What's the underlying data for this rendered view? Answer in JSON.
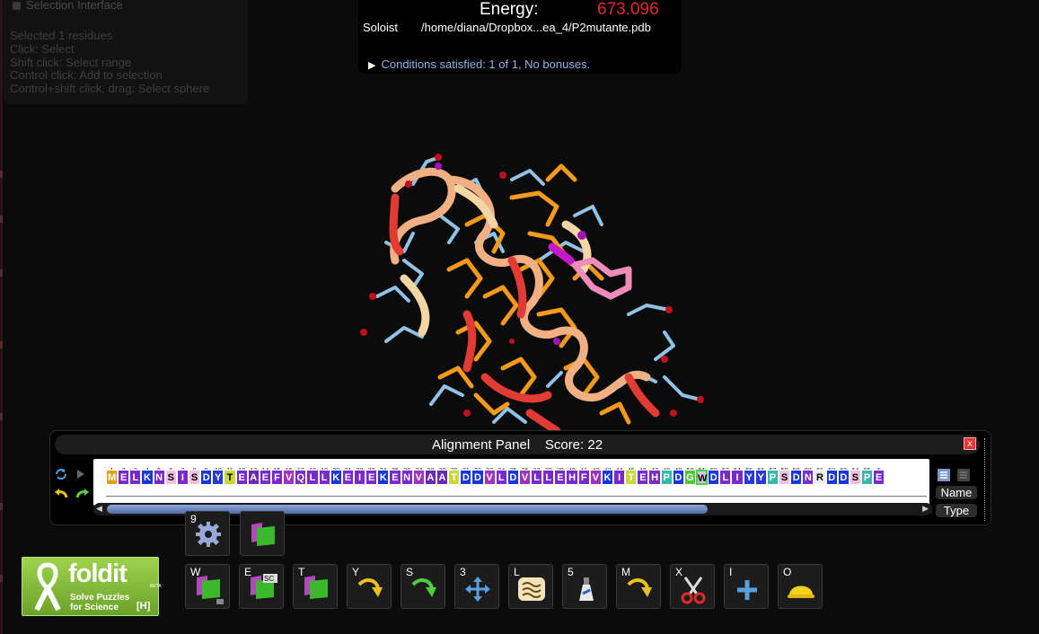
{
  "selection": {
    "title": "Selection Interface",
    "lines": [
      "Selected 1 residues",
      "Click: Select",
      "Shift click: Select range",
      "Control click: Add to selection",
      "Control+shift click, drag: Select sphere"
    ]
  },
  "energy": {
    "label": "Energy:",
    "value": "673.096",
    "mode": "Soloist",
    "file": "/home/diana/Dropbox...ea_4/P2mutante.pdb",
    "conditions": "Conditions satisfied: 1 of 1, No bonuses."
  },
  "alignment": {
    "title": "Alignment Panel",
    "score_label": "Score:",
    "score": "22",
    "close": "x",
    "name_btn": "Name",
    "type_btn": "Type",
    "residue_numbers": [
      "1",
      "2",
      "3",
      "4",
      "5",
      "6",
      "7",
      "8",
      "9",
      "10",
      "11",
      "12",
      "13",
      "14",
      "15",
      "16",
      "17",
      "18",
      "19",
      "20",
      "21",
      "22",
      "23",
      "24",
      "25",
      "26",
      "27",
      "28",
      "29",
      "30",
      "31",
      "32",
      "33",
      "34",
      "35",
      "36",
      "37",
      "38",
      "39",
      "40",
      "41",
      "42",
      "43",
      "44",
      "45",
      "46",
      "47",
      "48",
      "49",
      "50",
      "51",
      "52",
      "53",
      "54",
      "55",
      "56",
      "57",
      "58",
      "59",
      "60",
      "61",
      "62",
      "63",
      "64",
      "65",
      "6"
    ],
    "residues": [
      "M",
      "E",
      "L",
      "K",
      "N",
      "S",
      "I",
      "S",
      "D",
      "Y",
      "T",
      "E",
      "A",
      "E",
      "F",
      "V",
      "Q",
      "L",
      "L",
      "K",
      "E",
      "I",
      "E",
      "K",
      "E",
      "N",
      "V",
      "A",
      "A",
      "T",
      "D",
      "D",
      "V",
      "L",
      "D",
      "V",
      "L",
      "L",
      "E",
      "H",
      "F",
      "V",
      "K",
      "I",
      "T",
      "E",
      "H",
      "P",
      "D",
      "G",
      "W",
      "D",
      "L",
      "I",
      "Y",
      "Y",
      "P",
      "S",
      "D",
      "N",
      "R",
      "D",
      "D",
      "S",
      "P",
      "E"
    ],
    "scroll_position": 0.74
  },
  "tools_top": [
    {
      "key": "9",
      "icon": "gear-icon"
    },
    {
      "key": "",
      "icon": "flag-icon"
    }
  ],
  "tools": [
    {
      "key": "W",
      "icon": "wiggle-flag-icon"
    },
    {
      "key": "E",
      "icon": "sidechain-flag-icon",
      "badge": "SC"
    },
    {
      "key": "T",
      "icon": "flag-icon"
    },
    {
      "key": "Y",
      "icon": "rebuild-arrow-icon"
    },
    {
      "key": "S",
      "icon": "shake-arrow-icon"
    },
    {
      "key": "3",
      "icon": "move-icon"
    },
    {
      "key": "L",
      "icon": "bands-icon"
    },
    {
      "key": "5",
      "icon": "tube-icon"
    },
    {
      "key": "M",
      "icon": "mutate-arrow-icon"
    },
    {
      "key": "X",
      "icon": "scissors-icon"
    },
    {
      "key": "I",
      "icon": "insert-plus-icon"
    },
    {
      "key": "O",
      "icon": "helmet-icon"
    }
  ],
  "logo": {
    "brand": "foldit",
    "beta": "BETA",
    "tagline1": "Solve Puzzles",
    "tagline2": "for Science",
    "hotkey": "[H]"
  }
}
